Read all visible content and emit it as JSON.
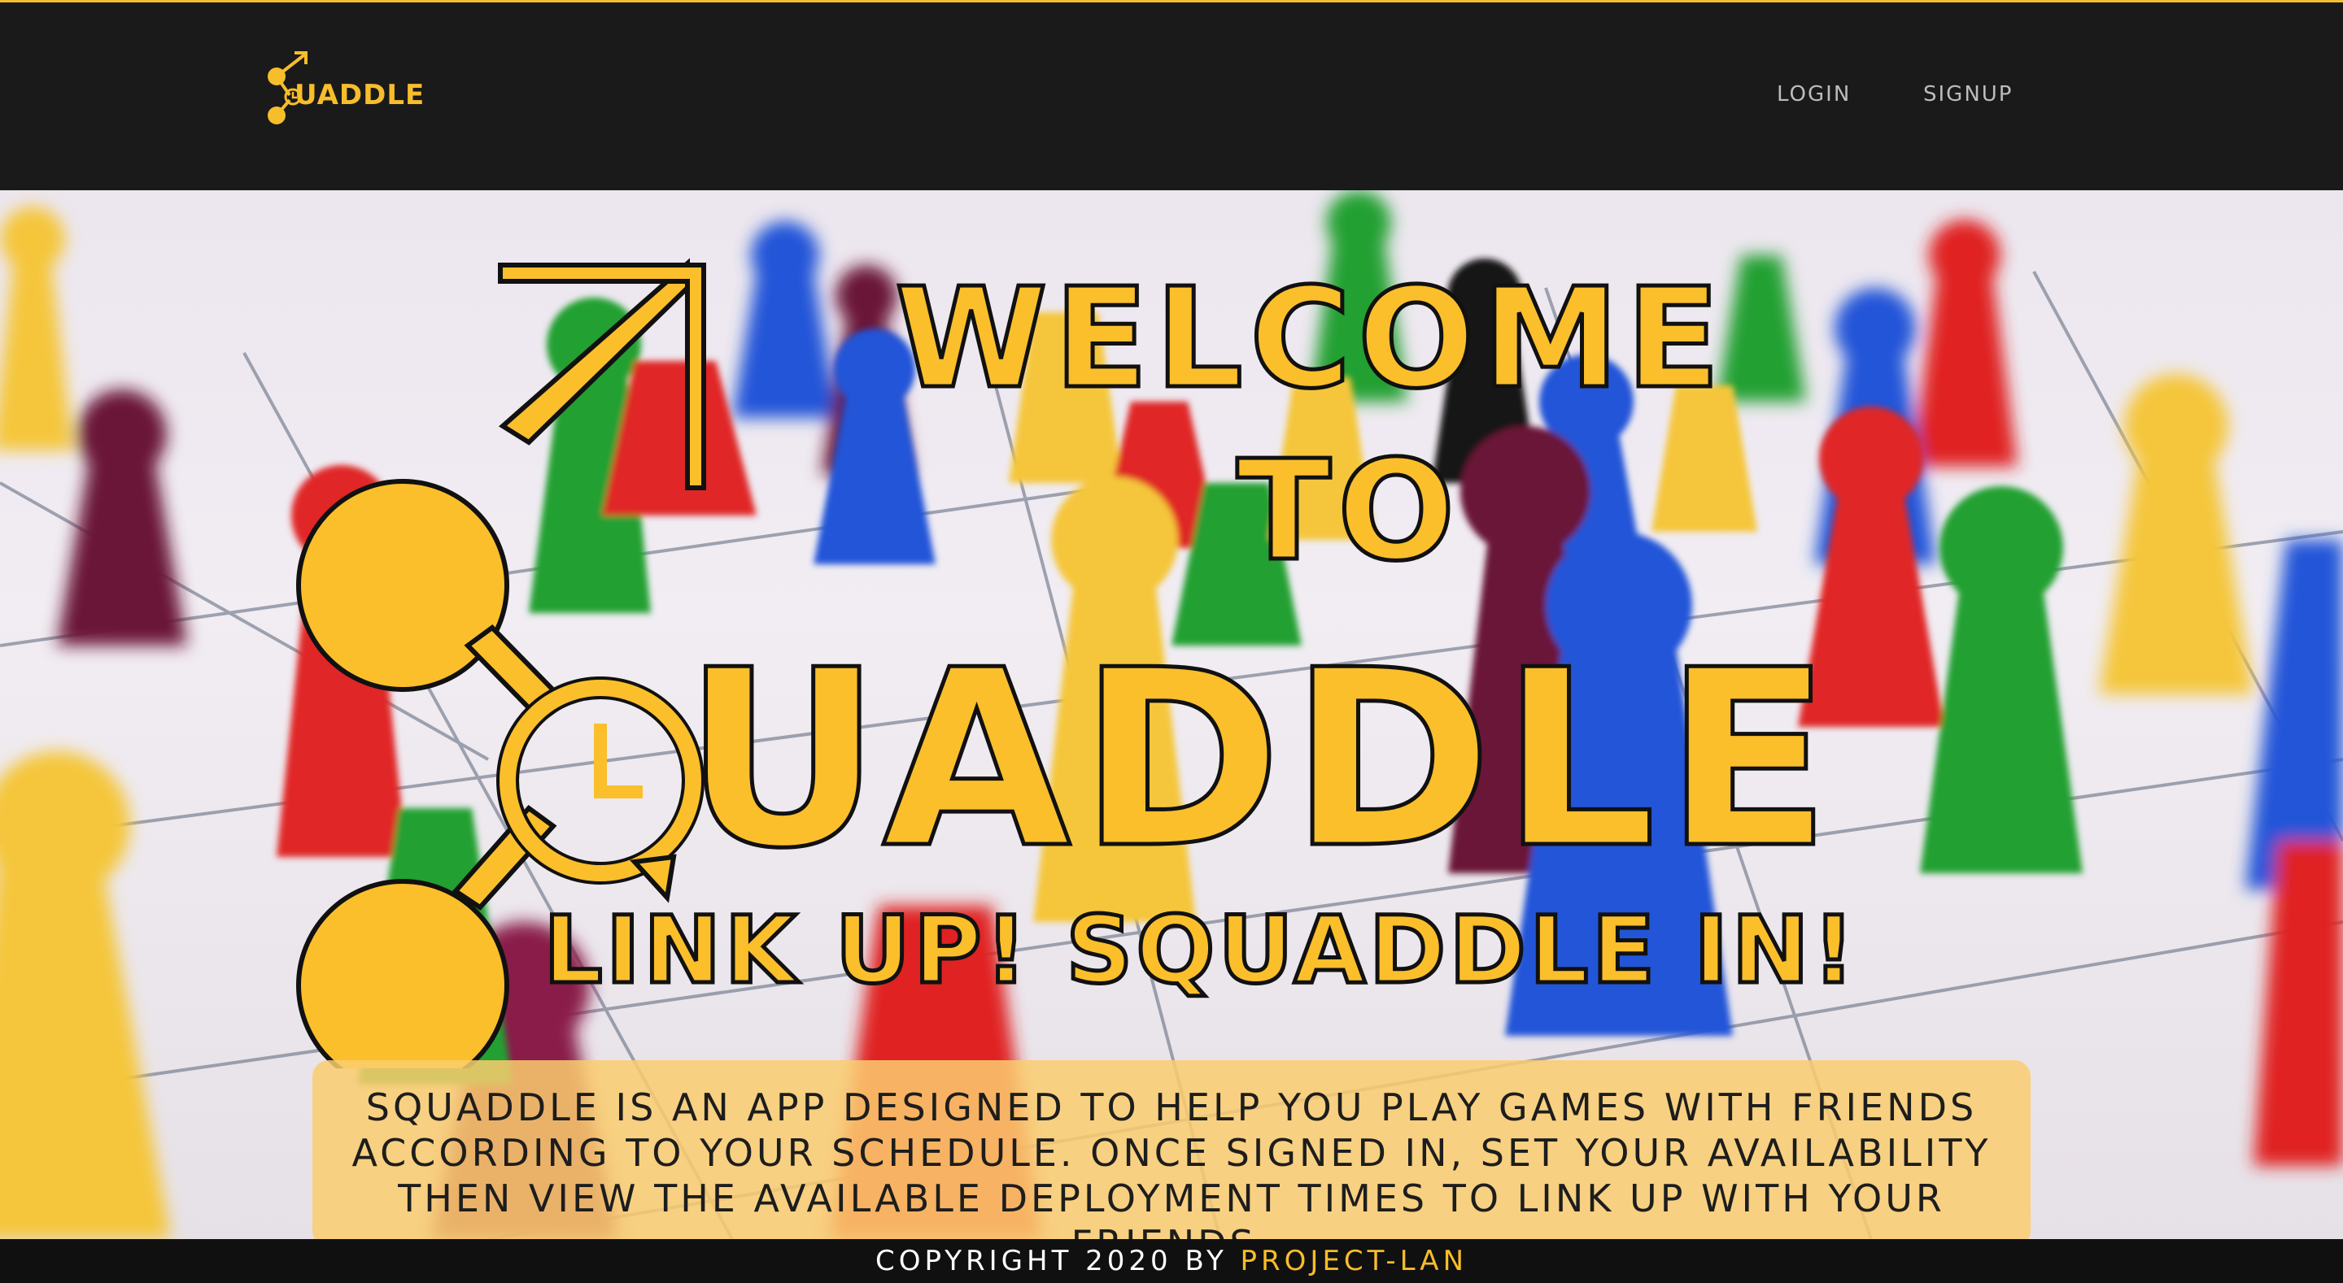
{
  "navbar": {
    "brand_text": "UADDLE",
    "links": [
      {
        "label": "LOGIN"
      },
      {
        "label": "SIGNUP"
      }
    ]
  },
  "hero": {
    "headline_line1": "WELCOME",
    "headline_line2": "TO",
    "logo_word": "UADDLE",
    "tagline": "LINK UP!  SQUADDLE IN!",
    "description": "SQUADDLE IS AN APP DESIGNED TO HELP YOU PLAY GAMES WITH FRIENDS ACCORDING TO YOUR SCHEDULE. ONCE SIGNED IN, SET YOUR AVAILABILITY THEN VIEW THE AVAILABLE DEPLOYMENT TIMES TO LINK UP WITH YOUR FRIENDS."
  },
  "footer": {
    "copyright_prefix": "COPYRIGHT 2020 BY ",
    "project_link": "PROJECT-LAN"
  },
  "colors": {
    "brand_yellow": "#f7bd2a",
    "navbar_bg": "#1a1a1a",
    "footer_bg": "#101010"
  }
}
